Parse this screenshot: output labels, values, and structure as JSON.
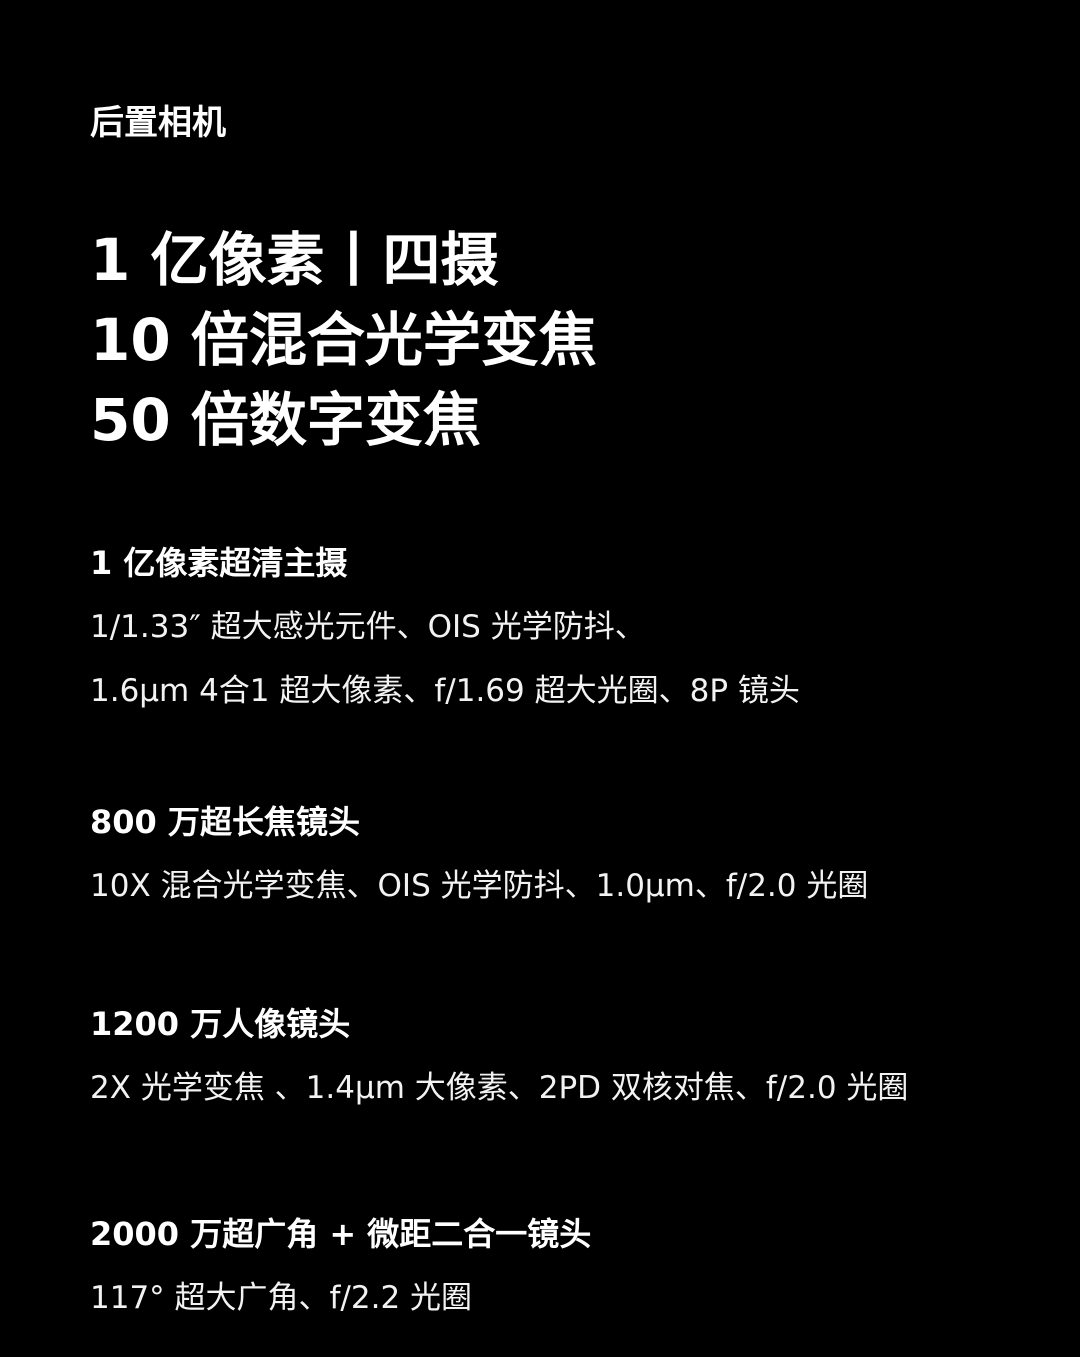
{
  "section_label": "后置相机",
  "headline": {
    "line1": "1 亿像素丨四摄",
    "line2": "10 倍混合光学变焦",
    "line3": "50 倍数字变焦"
  },
  "specs": [
    {
      "title": "1 亿像素超清主摄",
      "lines": [
        "1/1.33″ 超大感光元件、OIS 光学防抖、",
        "1.6μm 4合1 超大像素、f/1.69 超大光圈、8P 镜头"
      ]
    },
    {
      "title": "800 万超长焦镜头",
      "lines": [
        "10X 混合光学变焦、OIS 光学防抖、1.0μm、f/2.0 光圈"
      ]
    },
    {
      "title": "1200 万人像镜头",
      "lines": [
        "2X 光学变焦 、1.4μm 大像素、2PD 双核对焦、f/2.0 光圈"
      ]
    },
    {
      "title": "2000 万超广角 + 微距二合一镜头",
      "lines": [
        "117° 超大广角、f/2.2 光圈"
      ]
    }
  ],
  "colors": {
    "background": "#000000",
    "text": "#ffffff"
  }
}
